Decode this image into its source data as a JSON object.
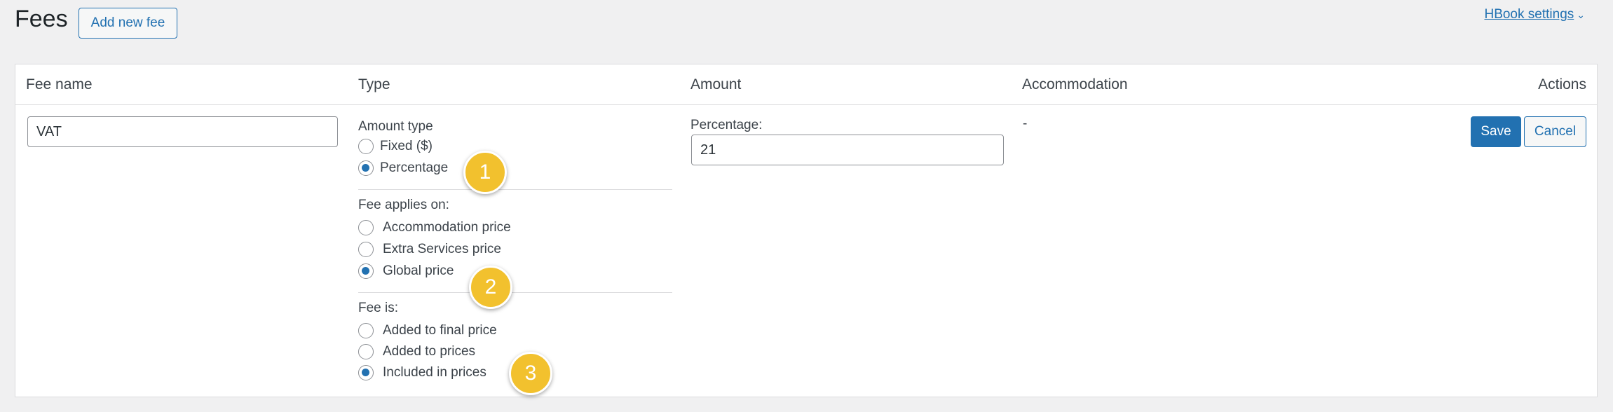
{
  "header": {
    "title": "Fees",
    "add_button": "Add new fee",
    "settings_link": "HBook settings",
    "settings_icon": "chevron-down-icon"
  },
  "table": {
    "columns": {
      "fee_name": "Fee name",
      "type": "Type",
      "amount": "Amount",
      "accommodation": "Accommodation",
      "actions": "Actions"
    },
    "row": {
      "fee_name_value": "VAT",
      "amount_type": {
        "label": "Amount type",
        "options": [
          {
            "label": "Fixed ($)",
            "checked": false
          },
          {
            "label": "Percentage",
            "checked": true
          }
        ]
      },
      "fee_applies_on": {
        "label": "Fee applies on:",
        "options": [
          {
            "label": "Accommodation price",
            "checked": false
          },
          {
            "label": "Extra Services price",
            "checked": false
          },
          {
            "label": "Global price",
            "checked": true
          }
        ]
      },
      "fee_is": {
        "label": "Fee is:",
        "options": [
          {
            "label": "Added to final price",
            "checked": false
          },
          {
            "label": "Added to prices",
            "checked": false
          },
          {
            "label": "Included in prices",
            "checked": true
          }
        ]
      },
      "percentage_label": "Percentage:",
      "percentage_value": "21",
      "accommodation_value": "-",
      "save_label": "Save",
      "cancel_label": "Cancel"
    }
  },
  "annotations": {
    "badge1": "1",
    "badge2": "2",
    "badge3": "3",
    "badge_color": "#f2c12e"
  },
  "colors": {
    "accent": "#2271b1",
    "background": "#f0f0f1"
  }
}
